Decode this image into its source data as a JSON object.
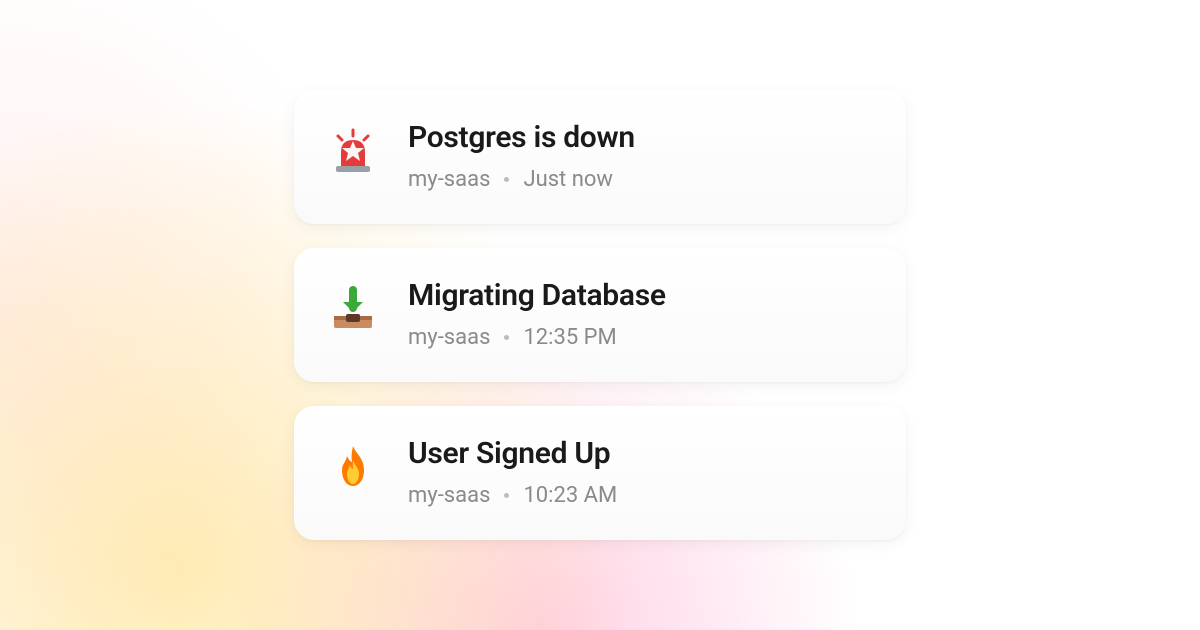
{
  "notifications": [
    {
      "icon": "siren",
      "title": "Postgres is down",
      "project": "my-saas",
      "time": "Just now"
    },
    {
      "icon": "inbox-download",
      "title": "Migrating Database",
      "project": "my-saas",
      "time": "12:35 PM"
    },
    {
      "icon": "fire",
      "title": "User Signed Up",
      "project": "my-saas",
      "time": "10:23 AM"
    }
  ]
}
